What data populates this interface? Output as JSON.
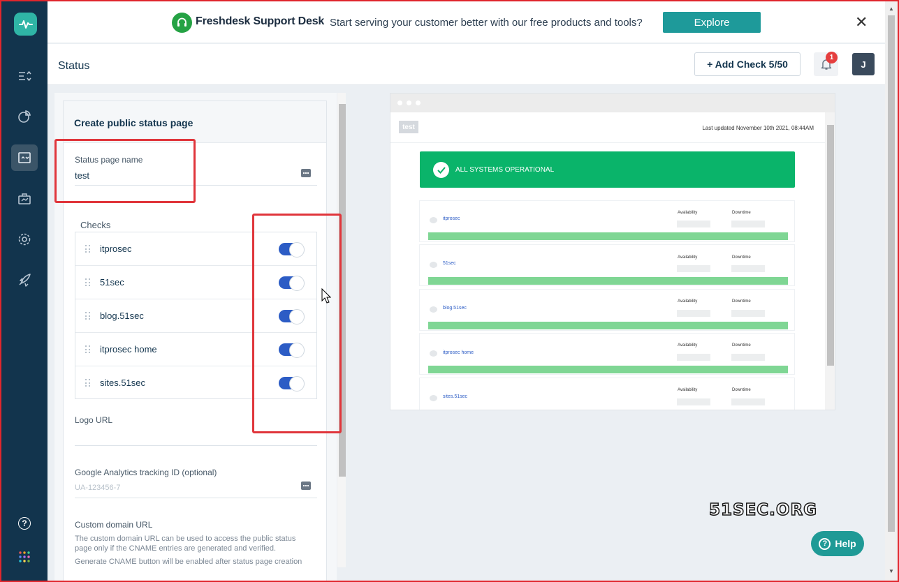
{
  "banner": {
    "brand": "Freshdesk Support Desk",
    "message": "Start serving your customer better with our free products and tools?",
    "explore_label": "Explore",
    "close_glyph": "✕"
  },
  "header": {
    "title": "Status",
    "add_check_label": "+ Add Check 5/50",
    "notification_count": "1",
    "avatar_initial": "J"
  },
  "sidebar": {
    "items": [
      {
        "icon": "logo-icon"
      },
      {
        "icon": "checks-list-icon"
      },
      {
        "icon": "reports-icon"
      },
      {
        "icon": "status-page-icon",
        "active": true
      },
      {
        "icon": "integrations-icon"
      },
      {
        "icon": "settings-icon"
      },
      {
        "icon": "rocket-icon"
      },
      {
        "icon": "help-icon"
      },
      {
        "icon": "apps-grid-icon"
      }
    ]
  },
  "form": {
    "heading": "Create public status page",
    "status_name": {
      "label": "Status page name",
      "value": "test"
    },
    "checks_label": "Checks",
    "checks": [
      {
        "name": "itprosec",
        "enabled": true
      },
      {
        "name": "51sec",
        "enabled": true
      },
      {
        "name": "blog.51sec",
        "enabled": true
      },
      {
        "name": "itprosec home",
        "enabled": true
      },
      {
        "name": "sites.51sec",
        "enabled": true
      }
    ],
    "logo_url": {
      "label": "Logo URL",
      "value": ""
    },
    "ga": {
      "label": "Google Analytics tracking ID (optional)",
      "placeholder": "UA-123456-7"
    },
    "custom_domain": {
      "label": "Custom domain URL",
      "help1": "The custom domain URL can be used to access the public status page only if the CNAME entries are generated and verified.",
      "help2": "Generate CNAME button will be enabled after status page creation"
    }
  },
  "preview": {
    "logo_text": "test",
    "last_updated": "Last updated November 10th 2021, 08:44AM",
    "operational_text": "ALL SYSTEMS OPERATIONAL",
    "availability_label": "Availability",
    "downtime_label": "Downtime",
    "checks": [
      "itprosec",
      "51sec",
      "blog.51sec",
      "itprosec home",
      "sites.51sec"
    ]
  },
  "watermark": "51SEC.ORG",
  "help_label": "Help",
  "colors": {
    "sidebar": "#12344d",
    "accent_teal": "#1e9a9a",
    "toggle_on": "#2c5cc5",
    "operational_green": "#0ab46a",
    "highlight_red": "#e0353b"
  }
}
